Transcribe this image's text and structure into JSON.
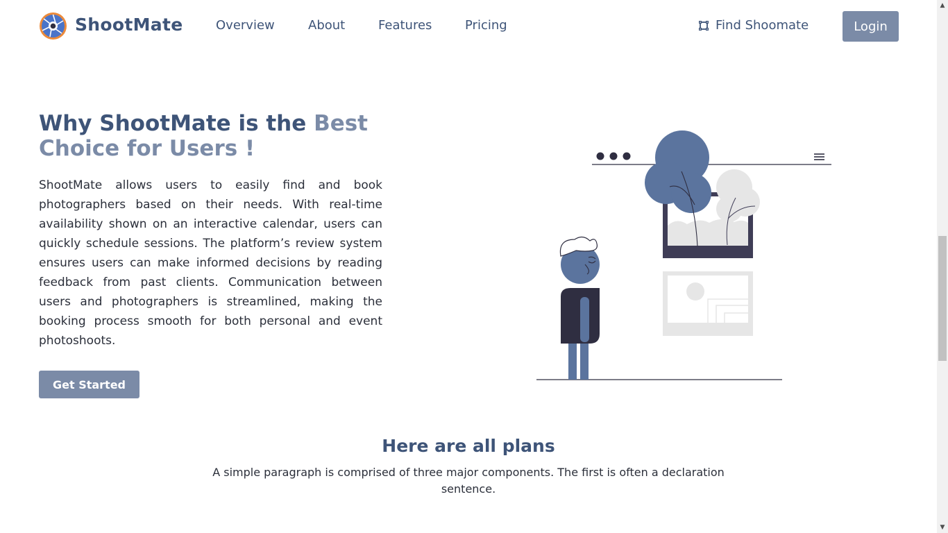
{
  "header": {
    "brand": "ShootMate",
    "nav": [
      "Overview",
      "About",
      "Features",
      "Pricing"
    ],
    "find_label": "Find Shoomate",
    "login_label": "Login",
    "icons": {
      "logo": "aperture-logo-icon",
      "find": "frame-icon"
    }
  },
  "hero": {
    "title_part1": "Why ShootMate is the ",
    "title_accent": "Best Choice for Users !",
    "paragraph": "ShootMate allows users to easily find and book photographers based on their needs. With real-time availability shown on an interactive calendar, users can quickly schedule sessions. The platform’s review system ensures users can make informed decisions by reading feedback from past clients. Communication between users and photographers is streamlined, making the booking process smooth for both personal and event photoshoots.",
    "cta_label": "Get Started"
  },
  "plans": {
    "title": "Here are all plans",
    "subtitle": "A simple paragraph is comprised of three major components. The first is often a declaration sentence."
  },
  "colors": {
    "primary": "#3e5478",
    "accent": "#7b8ba7",
    "illustration_blue": "#5b749e",
    "illustration_dark": "#2f2e41"
  }
}
